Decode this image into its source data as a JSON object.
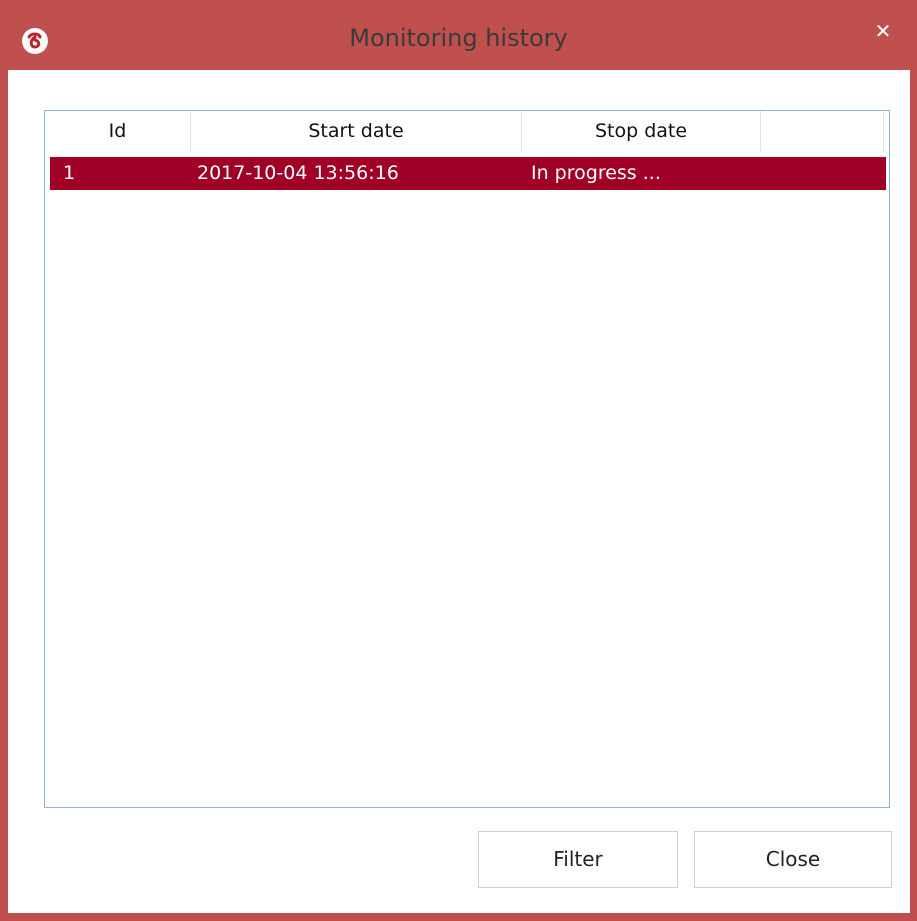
{
  "window": {
    "title": "Monitoring history",
    "close_glyph": "✕",
    "app_icon": "app-logo-icon",
    "accent_color": "#c0504e",
    "selection_color": "#a00026"
  },
  "table": {
    "columns": [
      "Id",
      "Start date",
      "Stop date",
      ""
    ],
    "rows": [
      {
        "id": "1",
        "start_date": "2017-10-04 13:56:16",
        "stop_date": "In progress ..."
      }
    ],
    "selected_row": 0
  },
  "buttons": {
    "filter_label": "Filter",
    "close_label": "Close"
  }
}
